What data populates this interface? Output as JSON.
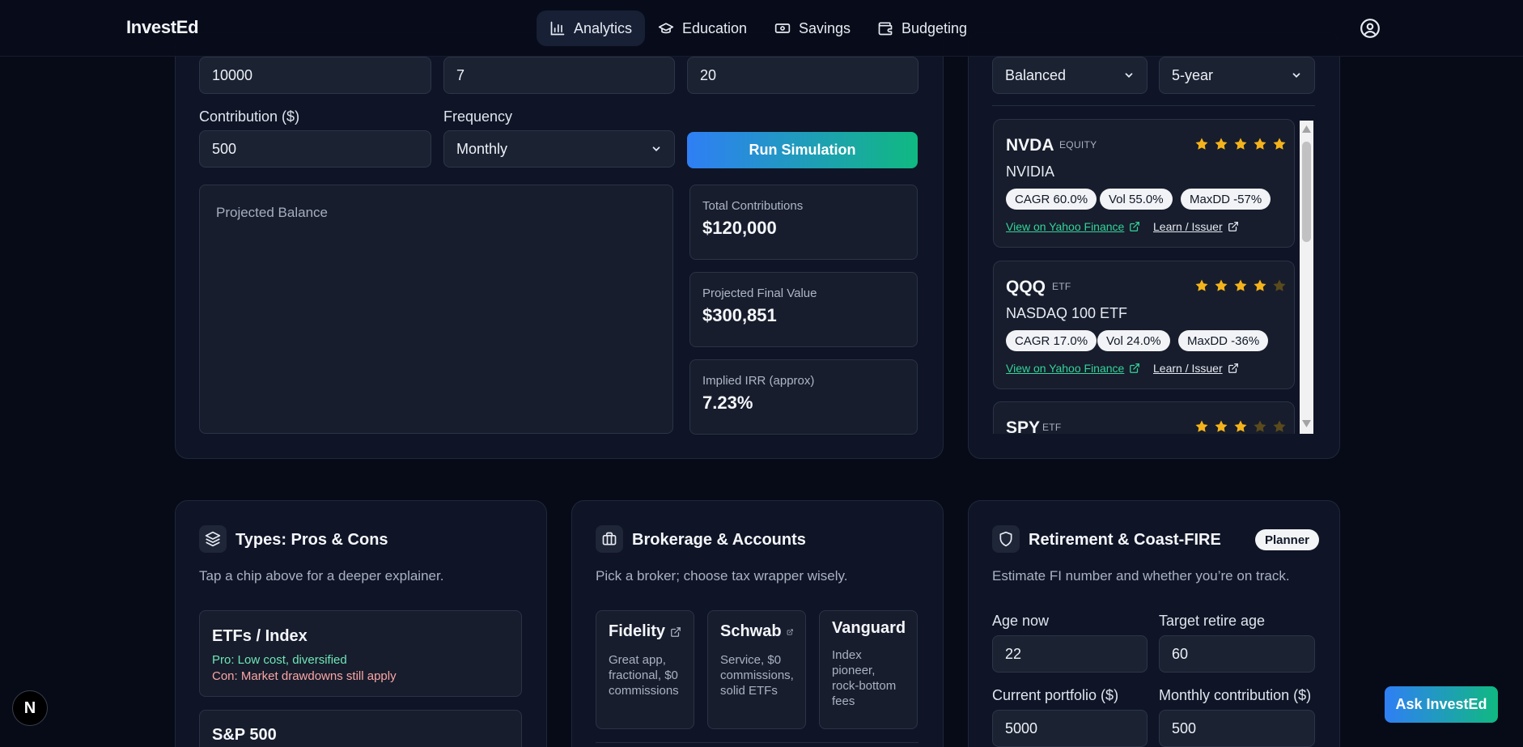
{
  "nav": {
    "brand": "InvestEd",
    "items": [
      {
        "label": "Analytics",
        "icon": "bar-chart-icon",
        "active": true
      },
      {
        "label": "Education",
        "icon": "graduation-cap-icon",
        "active": false
      },
      {
        "label": "Savings",
        "icon": "banknote-icon",
        "active": false
      },
      {
        "label": "Budgeting",
        "icon": "wallet-icon",
        "active": false
      }
    ],
    "profile_icon": "user-circle-icon"
  },
  "simulator": {
    "initial_value": "10000",
    "rate_value": "7",
    "years_value": "20",
    "contribution_label": "Contribution ($)",
    "contribution_value": "500",
    "frequency_label": "Frequency",
    "frequency_value": "Monthly",
    "run_label": "Run Simulation",
    "chart_title": "Projected Balance",
    "stats": [
      {
        "label": "Total Contributions",
        "value": "$120,000"
      },
      {
        "label": "Projected Final Value",
        "value": "$300,851"
      },
      {
        "label": "Implied IRR (approx)",
        "value": "7.23%"
      }
    ]
  },
  "recommendations": {
    "risk_value": "Balanced",
    "horizon_value": "5-year",
    "items": [
      {
        "ticker": "NVDA",
        "type": "EQUITY",
        "name": "NVIDIA",
        "stars": 5,
        "cagr": "CAGR 60.0%",
        "vol": "Vol 55.0%",
        "maxdd": "MaxDD -57%",
        "yahoo": "View on Yahoo Finance",
        "learn": "Learn / Issuer"
      },
      {
        "ticker": "QQQ",
        "type": "ETF",
        "name": "NASDAQ 100 ETF",
        "stars": 4,
        "cagr": "CAGR 17.0%",
        "vol": "Vol 24.0%",
        "maxdd": "MaxDD -36%",
        "yahoo": "View on Yahoo Finance",
        "learn": "Learn / Issuer"
      },
      {
        "ticker": "SPY",
        "type": "ETF",
        "stars": 3
      }
    ],
    "star_color": "#f5b31b",
    "star_dim_color": "#5a4a1c",
    "link_color": "#34d399"
  },
  "types_card": {
    "title": "Types: Pros & Cons",
    "subtitle": "Tap a chip above for a deeper explainer.",
    "items": [
      {
        "name": "ETFs / Index",
        "pro": "Pro: Low cost, diversified",
        "con": "Con: Market drawdowns still apply"
      },
      {
        "name": "S&P 500"
      }
    ],
    "pro_color": "#6ee7b7",
    "con_color": "#fca5a5"
  },
  "brokerage_card": {
    "title": "Brokerage & Accounts",
    "subtitle": "Pick a broker; choose tax wrapper wisely.",
    "brokers": [
      {
        "name": "Fidelity",
        "desc": "Great app, fractional, $0 commissions",
        "external": true
      },
      {
        "name": "Schwab",
        "desc": "Service, $0 commissions, solid ETFs",
        "external": true
      },
      {
        "name": "Vanguard",
        "desc": "Index pioneer, rock-bottom fees",
        "external": false
      }
    ]
  },
  "retirement_card": {
    "title": "Retirement & Coast-FIRE",
    "badge": "Planner",
    "subtitle": "Estimate FI number and whether you’re on track.",
    "fields": {
      "age_now_label": "Age now",
      "age_now_value": "22",
      "target_age_label": "Target retire age",
      "target_age_value": "60",
      "current_portfolio_label": "Current portfolio ($)",
      "current_portfolio_value": "5000",
      "monthly_contribution_label": "Monthly contribution ($)",
      "monthly_contribution_value": "500"
    }
  },
  "floating": {
    "ask_label": "Ask InvestEd",
    "dev_badge": "N"
  }
}
